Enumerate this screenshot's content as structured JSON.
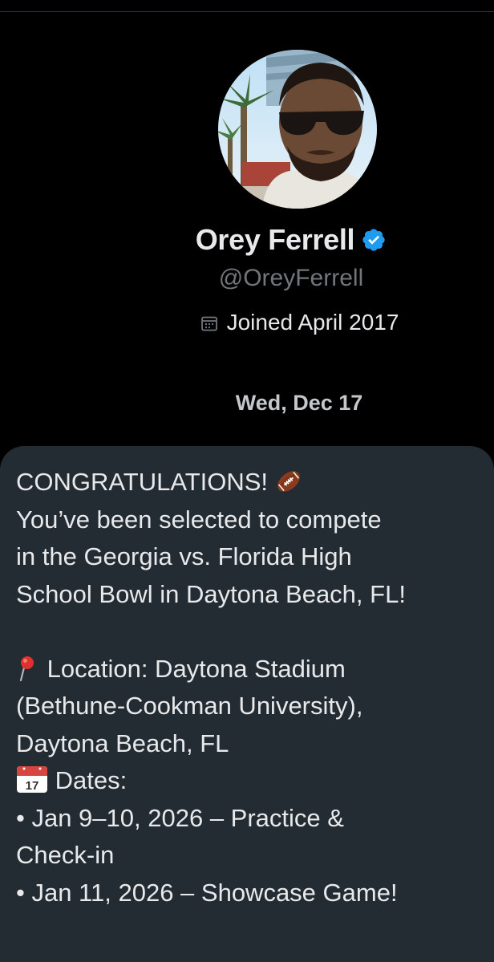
{
  "profile": {
    "display_name": "Orey Ferrell",
    "handle": "@OreyFerrell",
    "joined": "Joined April 2017",
    "verified": true,
    "verified_color": "#1d9bf0"
  },
  "conversation": {
    "date_separator": "Wed, Dec 17"
  },
  "message": {
    "lines": [
      "CONGRATULATIONS!",
      "You’ve been selected to compete",
      "in the Georgia vs. Florida High",
      "School Bowl in Daytona Beach, FL!",
      "",
      "Location: Daytona Stadium",
      "(Bethune-Cookman University),",
      "Daytona Beach, FL",
      "Dates:",
      "• Jan 9–10, 2026 – Practice &",
      "Check-in",
      "• Jan 11, 2026 – Showcase Game!"
    ],
    "icons": {
      "line0": "football-icon",
      "line5": "pin-icon",
      "line8": "calendar-date-icon"
    },
    "calendar_icon_text": "17",
    "bubble_color": "#242c33"
  }
}
